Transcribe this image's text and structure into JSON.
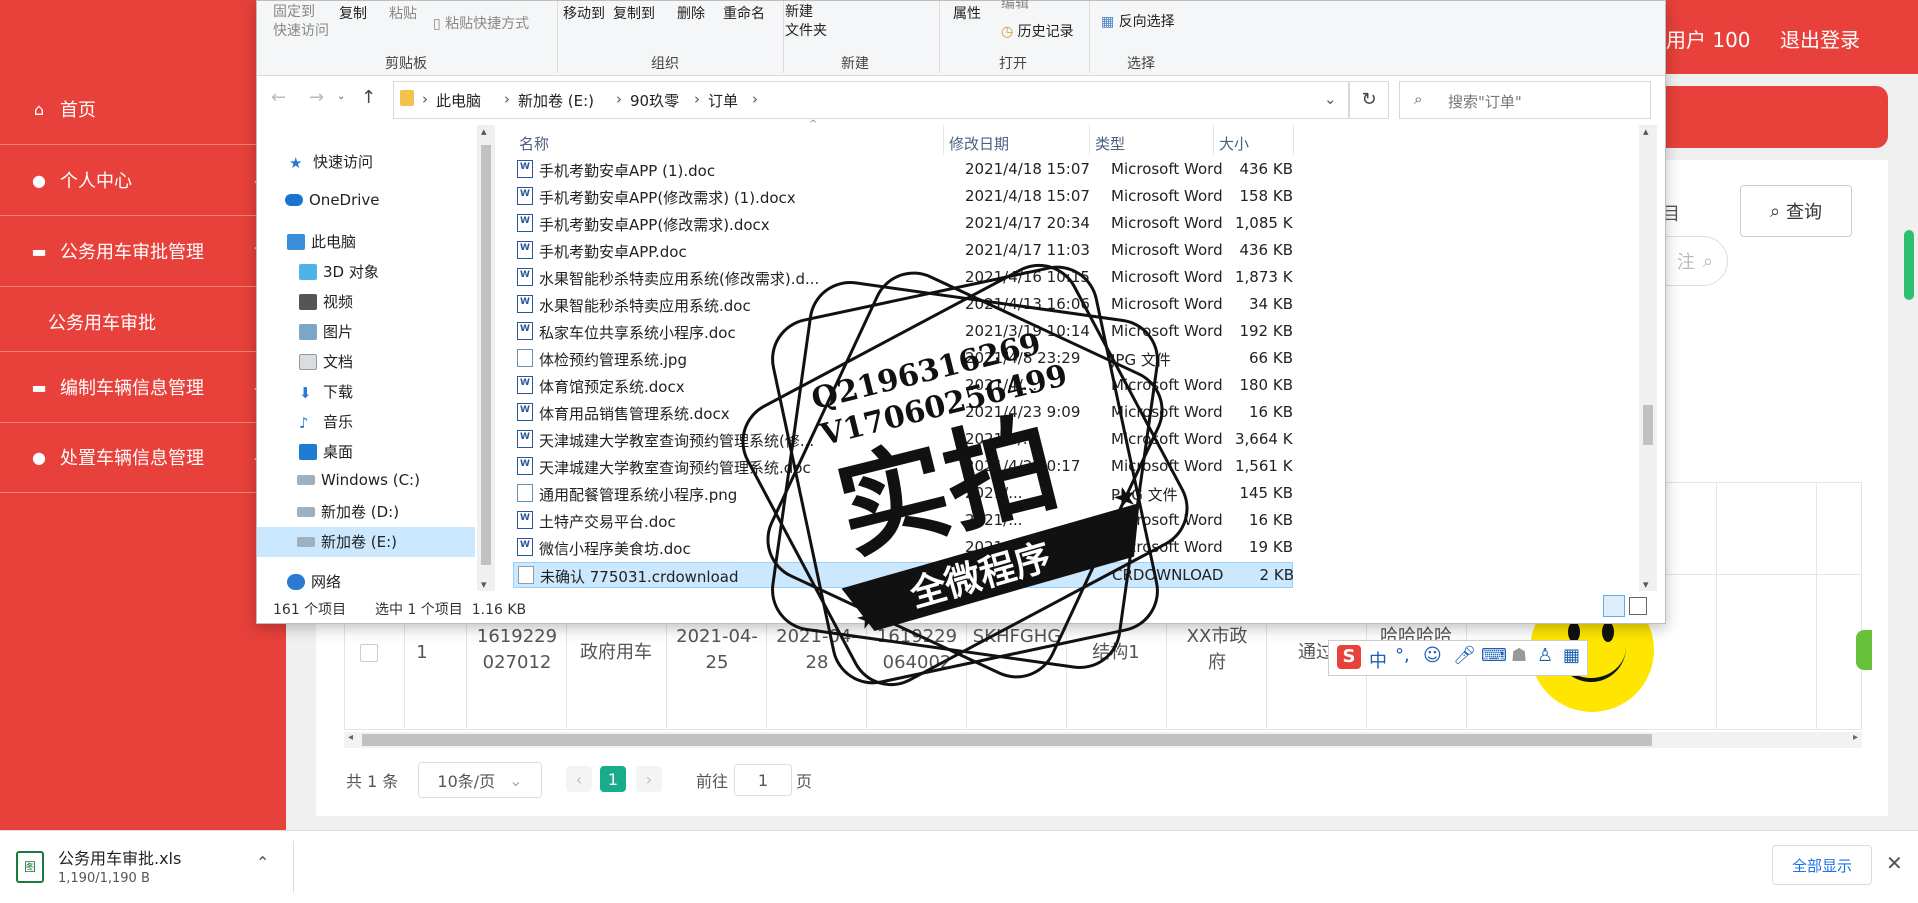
{
  "webapp": {
    "user_label": "用户 100",
    "logout": "退出登录",
    "menu": [
      {
        "label": "首页",
        "icon": "home-icon"
      },
      {
        "label": "个人中心",
        "icon": "person-icon"
      },
      {
        "label": "公务用车审批管理",
        "icon": "briefcase-icon"
      },
      {
        "label": "公务用车审批",
        "icon": ""
      },
      {
        "label": "编制车辆信息管理",
        "icon": "folder-icon"
      },
      {
        "label": "处置车辆信息管理",
        "icon": "person-icon"
      }
    ],
    "query_button": "查询",
    "search_pill_text": "注",
    "partial_label": "目",
    "table_row": {
      "index": "1",
      "id1": "1619229027012",
      "type": "政府用车",
      "date1": "2021-04-25",
      "date2": "2021-04-28",
      "id2": "1619229064002",
      "code": "VNSADAHSKHFGHG",
      "structure": "结构1",
      "org": "XX市政府",
      "status": "通过",
      "remark": "哈哈哈哈"
    },
    "pagination": {
      "total": "共 1 条",
      "page_size": "10条/页",
      "current_page": "1",
      "goto_label": "前往",
      "goto_value": "1",
      "page_unit": "页"
    }
  },
  "explorer": {
    "ribbon": {
      "pin_label": "固定到\n快速访问",
      "copy": "复制",
      "paste": "粘贴",
      "paste_shortcut": "粘贴快捷方式",
      "move_to": "移动到",
      "copy_to": "复制到",
      "delete": "删除",
      "rename": "重命名",
      "new_folder": "新建\n文件夹",
      "properties": "属性",
      "edit": "编辑",
      "history": "历史记录",
      "invert_select": "反向选择",
      "groups": {
        "clipboard": "剪贴板",
        "organize": "组织",
        "new": "新建",
        "open": "打开",
        "select": "选择"
      }
    },
    "breadcrumb": [
      "此电脑",
      "新加卷 (E:)",
      "90玖零",
      "订单"
    ],
    "search_placeholder": "搜索\"订单\"",
    "nav": [
      {
        "label": "快速访问",
        "icon": "star-icon"
      },
      {
        "label": "OneDrive",
        "icon": "cloud-icon"
      },
      {
        "label": "此电脑",
        "icon": "computer-icon"
      },
      {
        "label": "3D 对象",
        "icon": "cube-icon"
      },
      {
        "label": "视频",
        "icon": "video-icon"
      },
      {
        "label": "图片",
        "icon": "picture-icon"
      },
      {
        "label": "文档",
        "icon": "document-icon"
      },
      {
        "label": "下载",
        "icon": "download-icon"
      },
      {
        "label": "音乐",
        "icon": "music-icon"
      },
      {
        "label": "桌面",
        "icon": "desktop-icon"
      },
      {
        "label": "Windows (C:)",
        "icon": "drive-icon"
      },
      {
        "label": "新加卷 (D:)",
        "icon": "drive-icon"
      },
      {
        "label": "新加卷 (E:)",
        "icon": "drive-icon"
      },
      {
        "label": "网络",
        "icon": "network-icon"
      }
    ],
    "columns": {
      "name": "名称",
      "date": "修改日期",
      "type": "类型",
      "size": "大小"
    },
    "files": [
      {
        "name": "手机考勤安卓APP (1).doc",
        "date": "2021/4/18 15:07",
        "type": "Microsoft Word ...",
        "size": "436 KB",
        "kind": "word"
      },
      {
        "name": "手机考勤安卓APP(修改需求) (1).docx",
        "date": "2021/4/18 15:07",
        "type": "Microsoft Word ...",
        "size": "158 KB",
        "kind": "word"
      },
      {
        "name": "手机考勤安卓APP(修改需求).docx",
        "date": "2021/4/17 20:34",
        "type": "Microsoft Word ...",
        "size": "1,085 KB",
        "kind": "word"
      },
      {
        "name": "手机考勤安卓APP.doc",
        "date": "2021/4/17 11:03",
        "type": "Microsoft Word ...",
        "size": "436 KB",
        "kind": "word"
      },
      {
        "name": "水果智能秒杀特卖应用系统(修改需求).d...",
        "date": "2021/4/16 10:15",
        "type": "Microsoft Word ...",
        "size": "1,873 KB",
        "kind": "word"
      },
      {
        "name": "水果智能秒杀特卖应用系统.doc",
        "date": "2021/4/13 16:06",
        "type": "Microsoft Word ...",
        "size": "34 KB",
        "kind": "word"
      },
      {
        "name": "私家车位共享系统小程序.doc",
        "date": "2021/3/19 10:14",
        "type": "Microsoft Word ...",
        "size": "192 KB",
        "kind": "word"
      },
      {
        "name": "体检预约管理系统.jpg",
        "date": "2021/4/8 23:29",
        "type": "JPG 文件",
        "size": "66 KB",
        "kind": "img"
      },
      {
        "name": "体育馆预定系统.docx",
        "date": "2021/4/...",
        "type": "Microsoft Word ...",
        "size": "180 KB",
        "kind": "word"
      },
      {
        "name": "体育用品销售管理系统.docx",
        "date": "2021/4/23 9:09",
        "type": "Microsoft Word ...",
        "size": "16 KB",
        "kind": "word"
      },
      {
        "name": "天津城建大学教室查询预约管理系统(修...",
        "date": "2021/4/...",
        "type": "Microsoft Word ...",
        "size": "3,664 KB",
        "kind": "word"
      },
      {
        "name": "天津城建大学教室查询预约管理系统.doc",
        "date": "2021/4/20 0:17",
        "type": "Microsoft Word ...",
        "size": "1,561 KB",
        "kind": "word"
      },
      {
        "name": "通用配餐管理系统小程序.png",
        "date": "2021/...",
        "type": "PNG 文件",
        "size": "145 KB",
        "kind": "img"
      },
      {
        "name": "土特产交易平台.doc",
        "date": "2021/...",
        "type": "Microsoft Word ...",
        "size": "16 KB",
        "kind": "word"
      },
      {
        "name": "微信小程序美食坊.doc",
        "date": "2021/3/22 14:...",
        "type": "Microsoft Word ...",
        "size": "19 KB",
        "kind": "word"
      },
      {
        "name": "未确认 775031.crdownload",
        "date": "2021/...",
        "type": "CRDOWNLOAD ...",
        "size": "2 KB",
        "kind": "blank",
        "selected": true
      }
    ],
    "status": {
      "count": "161 个项目",
      "selected": "选中 1 个项目  1.16 KB"
    }
  },
  "download_bar": {
    "filename": "公务用车审批.xls",
    "progress": "1,190/1,190 B",
    "show_all": "全部显示"
  },
  "stamp": {
    "line1": "Q2196316269",
    "line2": "V17060256499",
    "big": "实拍",
    "banner": "全微程序"
  },
  "ime": {
    "lang": "中"
  }
}
